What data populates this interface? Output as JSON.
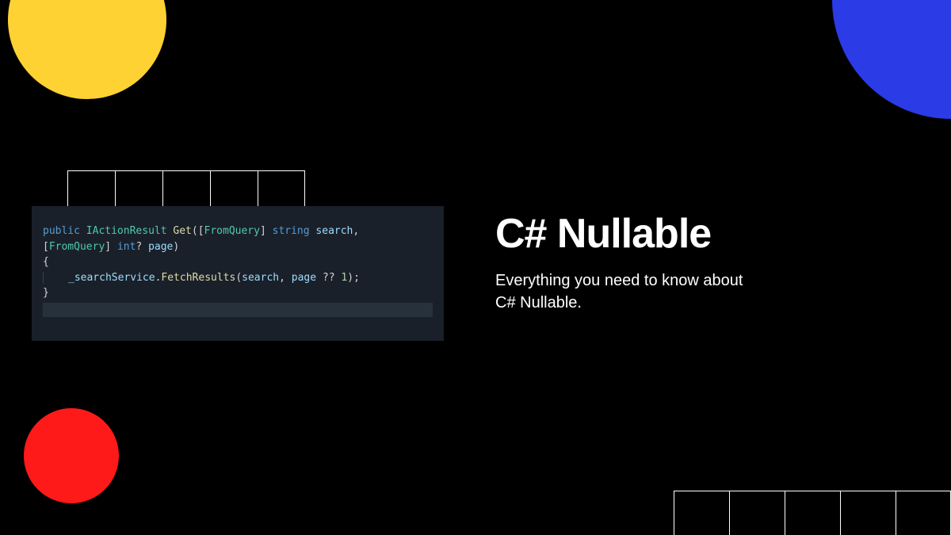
{
  "heading": "C# Nullable",
  "subheading_line1": "Everything you need to know about",
  "subheading_line2": "C# Nullable.",
  "code": {
    "t_public": "public",
    "t_iactionresult": "IActionResult",
    "t_get": "Get",
    "t_lparen1": "(",
    "t_lbracket1": "[",
    "t_fromquery1": "FromQuery",
    "t_rbracket1": "]",
    "t_string": "string",
    "t_search": "search",
    "t_comma1": ",",
    "t_lbracket2": "[",
    "t_fromquery2": "FromQuery",
    "t_rbracket2": "]",
    "t_int": "int",
    "t_qmark": "?",
    "t_page": "page",
    "t_rparen1": ")",
    "t_lbrace": "{",
    "t_searchservice": "_searchService",
    "t_dot": ".",
    "t_fetchresults": "FetchResults",
    "t_lparen2": "(",
    "t_search2": "search",
    "t_comma2": ",",
    "t_page2": "page",
    "t_coalesce": "??",
    "t_one": "1",
    "t_rparen2": ")",
    "t_semi": ";",
    "t_rbrace": "}"
  },
  "colors": {
    "yellow": "#FFD233",
    "blue": "#2B3BE5",
    "red": "#FF1A1A",
    "codebg": "#1a2029"
  }
}
